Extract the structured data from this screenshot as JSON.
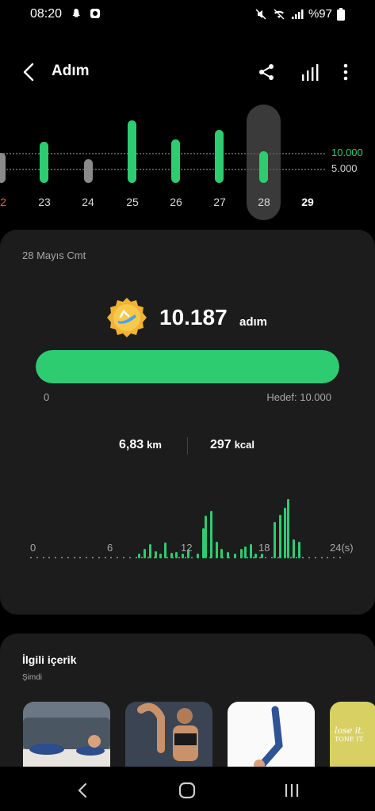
{
  "status": {
    "time": "08:20",
    "battery": "%97"
  },
  "header": {
    "title": "Adım",
    "icons": [
      "back-arrow-icon",
      "share-icon",
      "bar-chart-icon",
      "more-vert-icon"
    ]
  },
  "week": {
    "labels": [
      "2",
      "23",
      "24",
      "25",
      "26",
      "27",
      "28",
      "29"
    ],
    "selected": "28",
    "ref_high": "10.000",
    "ref_low": "5.000"
  },
  "summary": {
    "date": "28 Mayıs Cmt",
    "steps": "10.187",
    "steps_unit": "adım",
    "progress_percent": 100,
    "progress_min": "0",
    "goal_text": "Hedef: 10.000",
    "distance_value": "6,83",
    "distance_unit": "km",
    "calories_value": "297",
    "calories_unit": "kcal",
    "accent_color": "#2ecc71"
  },
  "hourly": {
    "axis_labels": [
      "0",
      "6",
      "12",
      "18",
      "24(s)"
    ]
  },
  "related": {
    "title": "İlgili içerik",
    "subtitle": "Şimdi",
    "thumb4_text_line1": "lose it.",
    "thumb4_text_line2": "TONE IT."
  }
}
